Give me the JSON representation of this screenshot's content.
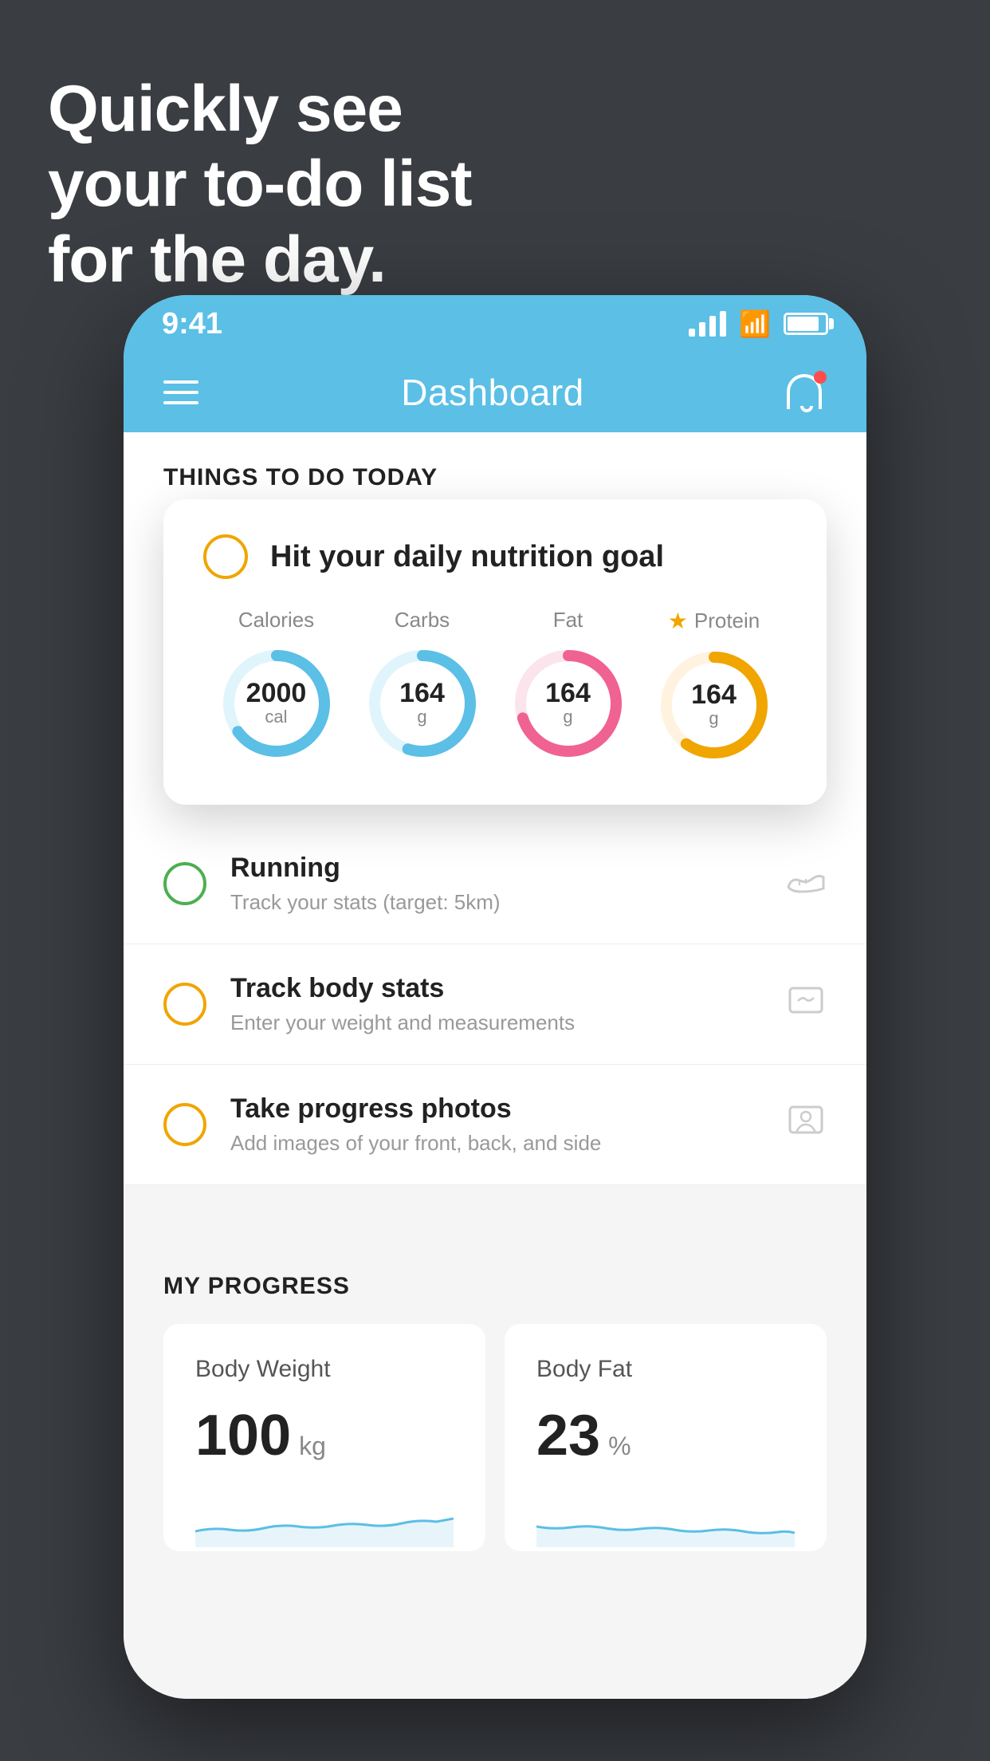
{
  "background": {
    "color": "#3a3d42"
  },
  "headline": {
    "line1": "Quickly see",
    "line2": "your to-do list",
    "line3": "for the day."
  },
  "phone": {
    "status_bar": {
      "time": "9:41"
    },
    "nav": {
      "title": "Dashboard"
    },
    "things_section": {
      "title": "THINGS TO DO TODAY"
    },
    "nutrition_card": {
      "title": "Hit your daily nutrition goal",
      "stats": [
        {
          "label": "Calories",
          "value": "2000",
          "unit": "cal",
          "color": "#5bbfe6",
          "track_color": "#e0f4fb",
          "percent": 65,
          "starred": false
        },
        {
          "label": "Carbs",
          "value": "164",
          "unit": "g",
          "color": "#5bbfe6",
          "track_color": "#e0f4fb",
          "percent": 55,
          "starred": false
        },
        {
          "label": "Fat",
          "value": "164",
          "unit": "g",
          "color": "#f06292",
          "track_color": "#fce4ec",
          "percent": 70,
          "starred": false
        },
        {
          "label": "Protein",
          "value": "164",
          "unit": "g",
          "color": "#f0a500",
          "track_color": "#fff3e0",
          "percent": 60,
          "starred": true
        }
      ]
    },
    "todo_items": [
      {
        "name": "Running",
        "description": "Track your stats (target: 5km)",
        "circle_color": "green",
        "icon": "👟"
      },
      {
        "name": "Track body stats",
        "description": "Enter your weight and measurements",
        "circle_color": "yellow",
        "icon": "⚖️"
      },
      {
        "name": "Take progress photos",
        "description": "Add images of your front, back, and side",
        "circle_color": "yellow",
        "icon": "👤"
      }
    ],
    "progress": {
      "title": "MY PROGRESS",
      "cards": [
        {
          "title": "Body Weight",
          "value": "100",
          "unit": "kg"
        },
        {
          "title": "Body Fat",
          "value": "23",
          "unit": "%"
        }
      ]
    }
  }
}
